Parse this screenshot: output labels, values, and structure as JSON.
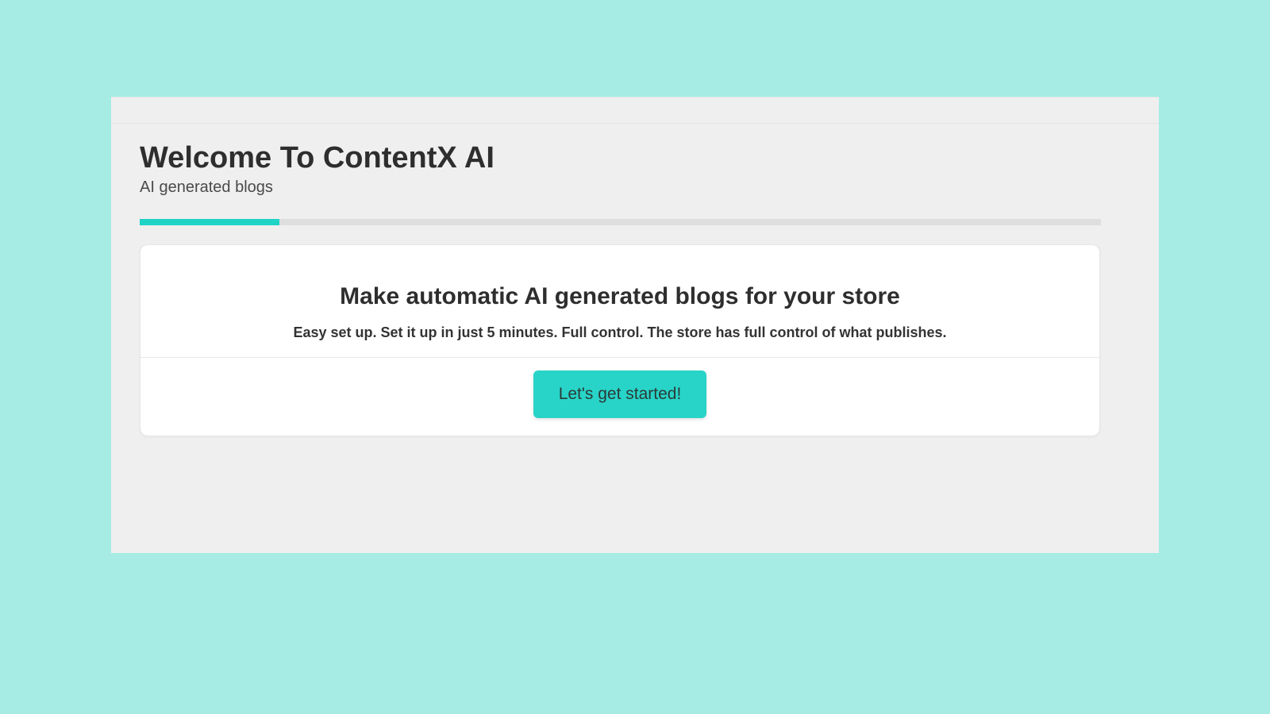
{
  "header": {
    "title": "Welcome To ContentX AI",
    "subtitle": "AI generated blogs"
  },
  "progress": {
    "percent": 14.5
  },
  "card": {
    "title": "Make automatic AI generated blogs for your store",
    "subtitle": "Easy set up. Set it up in just 5 minutes. Full control. The store has full control of what publishes.",
    "cta_label": "Let's get started!"
  },
  "colors": {
    "background": "#a6ece5",
    "panel": "#efefef",
    "accent": "#28d4c7",
    "progress_track": "#dedede",
    "progress_fill": "#1fd3c6",
    "card_bg": "#ffffff"
  }
}
